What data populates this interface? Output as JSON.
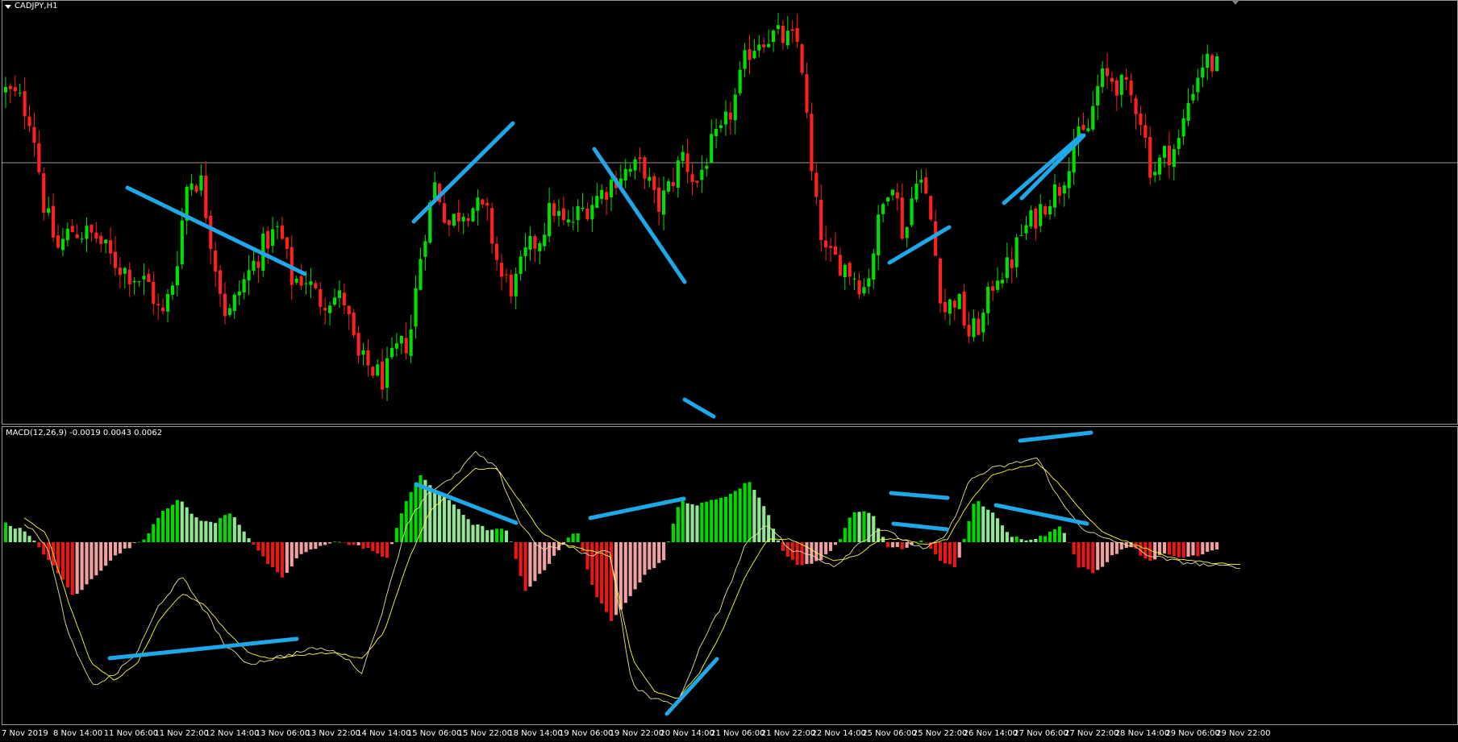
{
  "window": {
    "symbol_label": "CADJPY,H1",
    "indicator_label": "MACD(12,26,9) -0.0019 0.0043 0.0062"
  },
  "colors": {
    "background": "#000000",
    "bull_candle": "#00e000",
    "bear_candle": "#ff2020",
    "grid_line": "#c8c8c8",
    "annotation": "#1ea8e8",
    "hist_up_strong": "#00d800",
    "hist_up_weak": "#8fe88f",
    "hist_down_strong": "#e81818",
    "hist_down_weak": "#f0a0a0",
    "macd_line": "#e8e0a0",
    "signal_line": "#ffff30",
    "pane_border": "#9a9a9a"
  },
  "time_axis": {
    "labels": [
      "7 Nov 2019",
      "8 Nov 14:00",
      "11 Nov 06:00",
      "11 Nov 22:00",
      "12 Nov 14:00",
      "13 Nov 06:00",
      "13 Nov 22:00",
      "14 Nov 14:00",
      "15 Nov 06:00",
      "15 Nov 22:00",
      "18 Nov 14:00",
      "19 Nov 06:00",
      "19 Nov 22:00",
      "20 Nov 14:00",
      "21 Nov 06:00",
      "21 Nov 22:00",
      "22 Nov 14:00",
      "25 Nov 06:00",
      "25 Nov 22:00",
      "26 Nov 14:00",
      "27 Nov 06:00",
      "27 Nov 22:00",
      "28 Nov 14:00",
      "29 Nov 06:00",
      "29 Nov 22:00"
    ]
  },
  "chart_data": [
    {
      "type": "candlestick",
      "title": "CADJPY,H1",
      "x_anchors": [
        "7 Nov 2019",
        "8 Nov 14:00",
        "11 Nov 06:00",
        "11 Nov 22:00",
        "12 Nov 14:00",
        "13 Nov 06:00",
        "13 Nov 22:00",
        "14 Nov 14:00",
        "15 Nov 06:00",
        "15 Nov 22:00",
        "18 Nov 14:00",
        "19 Nov 06:00",
        "19 Nov 22:00",
        "20 Nov 14:00",
        "21 Nov 06:00",
        "21 Nov 22:00",
        "22 Nov 14:00",
        "25 Nov 06:00",
        "25 Nov 22:00",
        "26 Nov 14:00",
        "27 Nov 06:00",
        "27 Nov 22:00",
        "28 Nov 14:00",
        "29 Nov 06:00",
        "29 Nov 22:00"
      ],
      "close_path": [
        82,
        80,
        75,
        52,
        42,
        47,
        46,
        45,
        40,
        37,
        35,
        33,
        24,
        36,
        60,
        59,
        40,
        24,
        32,
        38,
        44,
        47,
        34,
        35,
        29,
        30,
        29,
        14,
        12,
        9,
        16,
        19,
        44,
        59,
        48,
        52,
        53,
        50,
        35,
        32,
        41,
        45,
        53,
        47,
        51,
        54,
        57,
        61,
        62,
        63,
        52,
        58,
        66,
        58,
        67,
        71,
        80,
        92,
        96,
        96,
        95,
        94,
        56,
        40,
        39,
        36,
        32,
        48,
        62,
        44,
        63,
        50,
        26,
        30,
        20,
        24,
        36,
        37,
        46,
        50,
        55,
        58,
        69,
        71,
        85,
        85,
        82,
        78,
        61,
        66,
        68,
        82,
        90,
        88
      ],
      "close_path_scale": "0 = lowest close, 100 = highest close (relative; price axis not shown)",
      "horizontal_line": true,
      "grid": false
    },
    {
      "type": "histogram+line",
      "title": "MACD(12,26,9) -0.0019 0.0043 0.0062",
      "values_printed": [
        -0.0019,
        0.0043,
        0.0062
      ],
      "histogram_path": [
        0.3,
        0.2,
        -0.1,
        -0.5,
        -0.9,
        -0.6,
        -0.3,
        -0.1,
        0.05,
        0.5,
        0.7,
        0.4,
        0.3,
        0.5,
        0.1,
        -0.3,
        -0.6,
        -0.2,
        -0.1,
        0.03,
        -0.05,
        -0.1,
        -0.3,
        0.6,
        1.1,
        0.8,
        0.6,
        0.3,
        0.2,
        0.2,
        -0.8,
        -0.5,
        -0.1,
        0.2,
        -0.8,
        -1.3,
        -0.9,
        -0.5,
        -0.3,
        0.7,
        0.6,
        0.7,
        0.8,
        1.0,
        0.5,
        -0.2,
        -0.4,
        -0.3,
        -0.05,
        0.5,
        0.5,
        -0.1,
        -0.1,
        0.05,
        -0.3,
        -0.4,
        0.7,
        0.5,
        0.1,
        0.05,
        0.1,
        0.3,
        -0.4,
        -0.5,
        -0.2,
        -0.05,
        -0.3,
        -0.2,
        -0.25,
        -0.2,
        -0.1
      ],
      "macd_path": [
        70,
        62,
        28,
        10,
        14,
        22,
        40,
        50,
        38,
        24,
        18,
        20,
        22,
        24,
        22,
        15,
        40,
        70,
        82,
        86,
        96,
        90,
        70,
        60,
        62,
        58,
        60,
        10,
        5,
        3,
        24,
        40,
        62,
        70,
        60,
        58,
        54,
        62,
        68,
        64,
        60,
        66,
        86,
        90,
        92,
        94,
        78,
        68,
        64,
        62,
        58,
        56,
        55,
        54,
        54
      ],
      "signal_path": [
        72,
        66,
        40,
        18,
        12,
        18,
        34,
        44,
        40,
        30,
        22,
        20,
        21,
        22,
        22,
        20,
        30,
        55,
        74,
        82,
        90,
        90,
        78,
        66,
        62,
        60,
        58,
        20,
        8,
        5,
        15,
        30,
        50,
        64,
        64,
        60,
        56,
        58,
        64,
        64,
        62,
        64,
        78,
        88,
        90,
        92,
        84,
        74,
        66,
        63,
        60,
        57,
        56,
        55,
        55
      ],
      "line_path_scale": "0 = lowest, 100 = highest (relative; indicator axis not shown)",
      "zero_line": true
    }
  ]
}
